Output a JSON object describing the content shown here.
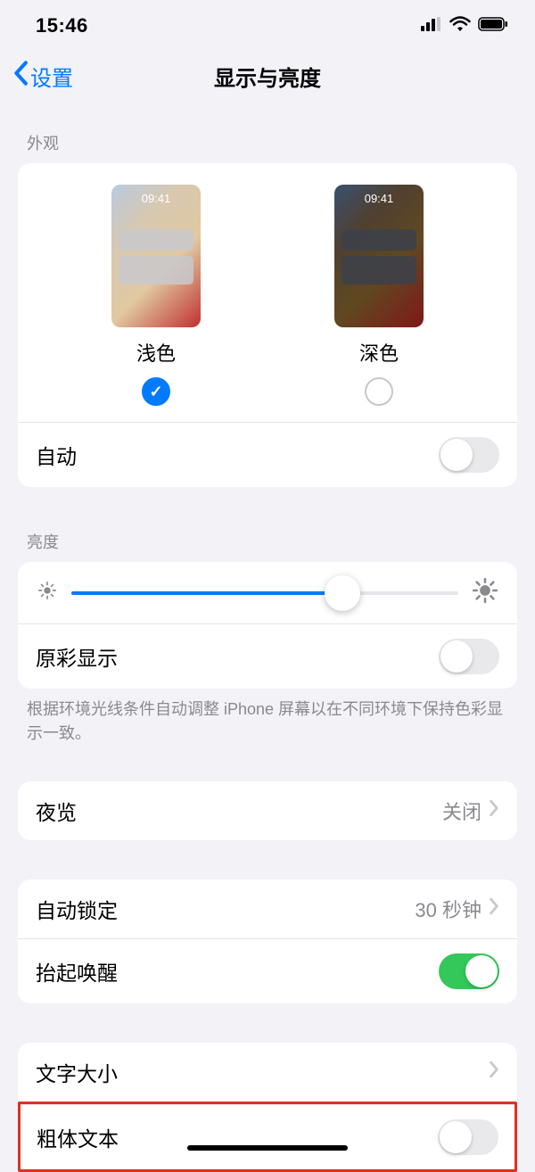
{
  "status": {
    "time": "15:46"
  },
  "nav": {
    "back": "设置",
    "title": "显示与亮度"
  },
  "appearance": {
    "header": "外观",
    "preview_time": "09:41",
    "options": [
      {
        "label": "浅色",
        "selected": true
      },
      {
        "label": "深色",
        "selected": false
      }
    ],
    "auto_label": "自动",
    "auto_on": false
  },
  "brightness": {
    "header": "亮度",
    "value_pct": 70,
    "true_tone_label": "原彩显示",
    "true_tone_on": false,
    "footer": "根据环境光线条件自动调整 iPhone 屏幕以在不同环境下保持色彩显示一致。"
  },
  "night_shift": {
    "label": "夜览",
    "value": "关闭"
  },
  "auto_lock": {
    "label": "自动锁定",
    "value": "30 秒钟"
  },
  "raise_to_wake": {
    "label": "抬起唤醒",
    "on": true
  },
  "text_size": {
    "label": "文字大小"
  },
  "bold_text": {
    "label": "粗体文本",
    "on": false
  }
}
